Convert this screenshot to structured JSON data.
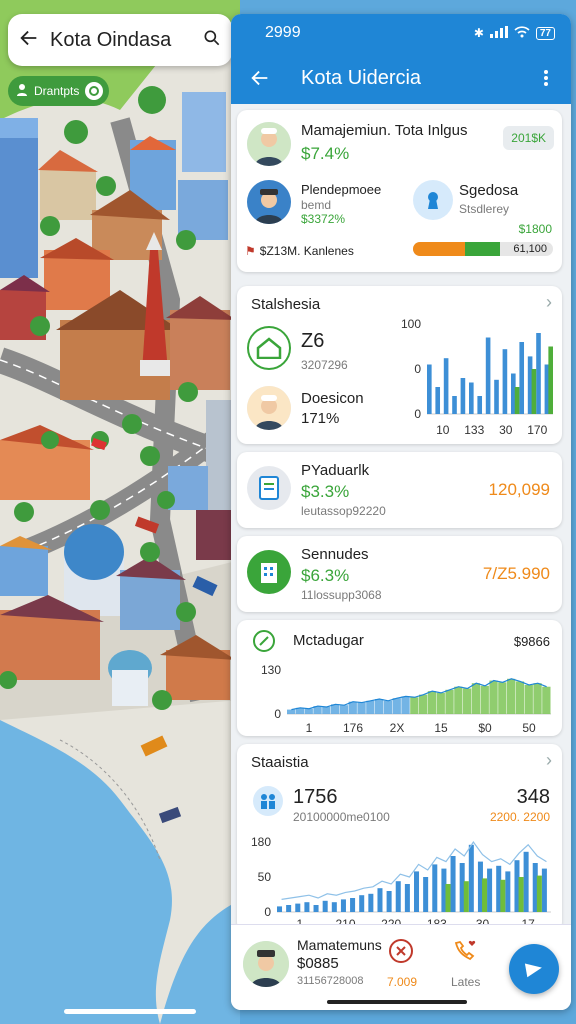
{
  "map": {
    "search_title": "Kota Oindasa",
    "chip_label": "Drantpts"
  },
  "status_bar": {
    "time": "2999",
    "battery": "77"
  },
  "app_bar": {
    "title": "Kota Uidercia"
  },
  "overview_card": {
    "title": "Mamajemiun. Tota  Inlgus",
    "value": "$7.4%",
    "badge": "201$K",
    "person_name": "Plendepmoee",
    "person_sub": "bemd",
    "person_value": "$3372%",
    "metric_title": "Sgedosa",
    "metric_sub": "Stsdlerey",
    "metric_value": "$1800",
    "footer_text": "$Z13M. Kanlenes",
    "progress_label": "61,100",
    "progress": 0.62
  },
  "stats_card": {
    "title": "Stalshesia",
    "item1_value": "Z6",
    "item1_sub": "3207296",
    "item2_title": "Doesicon",
    "item2_value": "171%"
  },
  "list_items": [
    {
      "title": "PYaduarlk",
      "value": "$3.3%",
      "sub": "leutassop92220",
      "amount": "120,099"
    },
    {
      "title": "Sennudes",
      "value": "$6.3%",
      "sub": "11lossupp3068",
      "amount": "7/Z5.990"
    }
  ],
  "trend_card": {
    "title": "Mctadugar",
    "value": "$9866"
  },
  "stats2_card": {
    "title": "Staaistia",
    "left_value": "1756",
    "left_sub": "20100000me0100",
    "right_value": "348",
    "right_sub": "2200. 2200"
  },
  "bottom_nav": {
    "name": "Mamatemuns",
    "value": "$0885",
    "sub": "31156728008",
    "item2_label": "7.009",
    "item3_label": "Lates"
  },
  "colors": {
    "primary": "#1f86d6",
    "green": "#3aa53a",
    "orange": "#ef8a1a"
  },
  "chart_data": [
    {
      "type": "bar",
      "yticks": [
        "100",
        "0",
        "0"
      ],
      "xticks": [
        "10",
        "133",
        "30",
        "170"
      ],
      "series": [
        {
          "values": [
            55,
            30,
            62,
            20,
            40,
            35,
            20,
            85,
            38,
            72,
            45,
            80,
            64,
            90,
            55
          ]
        },
        {
          "values": [
            0,
            0,
            0,
            0,
            0,
            0,
            0,
            0,
            0,
            0,
            30,
            0,
            50,
            0,
            75
          ]
        }
      ]
    },
    {
      "type": "area",
      "yticks": [
        "130",
        "0"
      ],
      "xticks": [
        "1",
        "176",
        "2X",
        "15",
        "$0",
        "50"
      ],
      "series": [
        {
          "values": [
            10,
            14,
            12,
            18,
            16,
            22,
            20,
            28,
            26,
            30,
            34,
            30,
            36,
            40,
            38,
            44,
            52,
            48,
            55,
            62,
            58,
            70,
            64,
            76,
            72,
            80,
            74,
            66,
            70,
            62
          ]
        }
      ]
    },
    {
      "type": "bar",
      "yticks": [
        "180",
        "50",
        "0"
      ],
      "xticks": [
        "1",
        "210",
        "220",
        "183",
        "30",
        "17"
      ],
      "series": [
        {
          "values": [
            8,
            10,
            12,
            14,
            10,
            16,
            14,
            18,
            20,
            24,
            26,
            34,
            30,
            44,
            40,
            58,
            50,
            68,
            62,
            80,
            70,
            96,
            72,
            62,
            66,
            58,
            74,
            86,
            70,
            62
          ]
        },
        {
          "values": [
            0,
            0,
            0,
            0,
            0,
            0,
            0,
            0,
            0,
            0,
            0,
            0,
            0,
            0,
            0,
            0,
            0,
            0,
            40,
            0,
            44,
            0,
            48,
            0,
            46,
            0,
            50,
            0,
            52,
            0
          ]
        }
      ]
    }
  ]
}
